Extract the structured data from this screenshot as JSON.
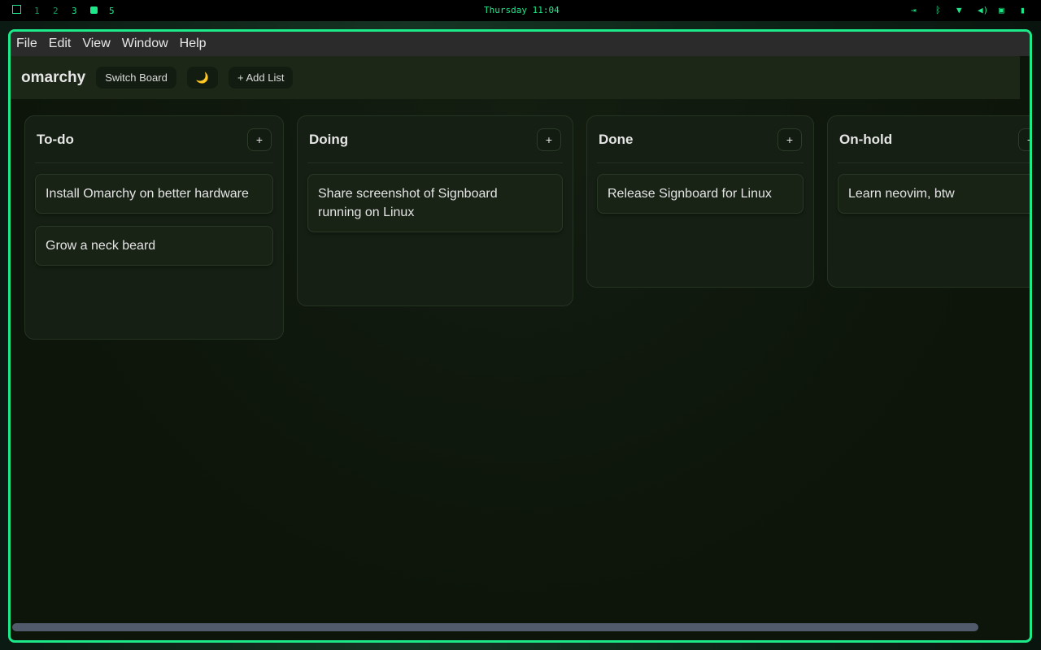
{
  "topbar": {
    "workspaces": [
      "1",
      "2",
      "3",
      "5"
    ],
    "clock": "Thursday 11:04"
  },
  "menu": [
    "File",
    "Edit",
    "View",
    "Window",
    "Help"
  ],
  "header": {
    "board": "omarchy",
    "switch": "Switch Board",
    "theme": "🌙",
    "add_list": "+ Add List"
  },
  "lists": [
    {
      "title": "To-do",
      "add": "+",
      "cards": [
        "Install Omarchy on better hardware",
        "Grow a neck beard"
      ]
    },
    {
      "title": "Doing",
      "add": "+",
      "cards": [
        "Share screenshot of Signboard running on Linux"
      ]
    },
    {
      "title": "Done",
      "add": "+",
      "cards": [
        "Release Signboard for Linux"
      ]
    },
    {
      "title": "On-hold",
      "add": "+",
      "cards": [
        "Learn neovim, btw"
      ]
    }
  ]
}
